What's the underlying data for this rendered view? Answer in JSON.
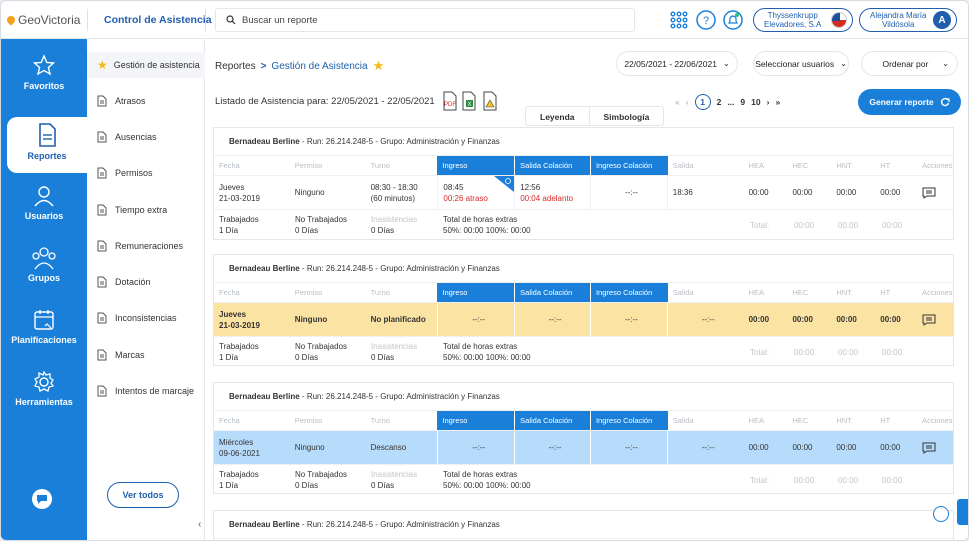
{
  "app": {
    "logo": "GeoVictoria",
    "module": "Control de Asistencia"
  },
  "search": {
    "placeholder": "Buscar un reporte"
  },
  "company": {
    "line1": "Thyssenkrupp",
    "line2": "Elevadores, S.A"
  },
  "user": {
    "line1": "Alejandra María",
    "line2": "Vildósola",
    "initial": "A"
  },
  "leftnav": [
    {
      "label": "Favoritos",
      "icon": "star-icon"
    },
    {
      "label": "Reportes",
      "icon": "report-icon",
      "active": true
    },
    {
      "label": "Usuarios",
      "icon": "users-icon"
    },
    {
      "label": "Grupos",
      "icon": "groups-icon"
    },
    {
      "label": "Planificaciones",
      "icon": "calendar-icon"
    },
    {
      "label": "Herramientas",
      "icon": "gear-icon"
    }
  ],
  "subnav": {
    "items": [
      "Gestión de asistencia",
      "Atrasos",
      "Ausencias",
      "Permisos",
      "Tiempo extra",
      "Remuneraciones",
      "Dotación",
      "Inconsistencias",
      "Marcas",
      "Intentos de marcaje"
    ],
    "ver_todos": "Ver todos"
  },
  "breadcrumb": {
    "root": "Reportes",
    "sep": ">",
    "current": "Gestión de Asistencia"
  },
  "filters": {
    "date_range": "22/05/2021 - 22/06/2021",
    "users": "Seleccionar usuarios",
    "order": "Ordenar por"
  },
  "list": {
    "title": "Listado de Asistencia para: 22/05/2021 - 22/05/2021"
  },
  "tabs": [
    "Leyenda",
    "Simbología"
  ],
  "pager": {
    "first": "«",
    "prev": "‹",
    "current": "1",
    "p2": "2",
    "dots": "...",
    "p9": "9",
    "p10": "10",
    "next": "›",
    "last": "»"
  },
  "generate_label": "Generar reporte",
  "columns": [
    "Fecha",
    "Permiso",
    "Turno",
    "Ingreso",
    "Salida Colación",
    "Ingreso Colación",
    "Salida",
    "HEA",
    "HEC",
    "HNT",
    "HT",
    "Acciones"
  ],
  "cards": [
    {
      "name": "Bernadeau Berline",
      "run_label": " - Run: 26.214.248-5 - Grupo: Administración y Finanzas",
      "row": {
        "day": "Jueves",
        "date": "21-03-2019",
        "permiso": "Ninguno",
        "turno1": "08:30 - 18:30",
        "turno2": "(60 minutos)",
        "ingreso": "08:45",
        "ingreso_note": "00:26 atraso",
        "salida_col": "12:56",
        "salida_col_note": "00:04 adelanto",
        "ingreso_col": "--:--",
        "salida": "18:36",
        "hea": "00:00",
        "hec": "00:00",
        "hnt": "00:00",
        "ht": "00:00"
      }
    },
    {
      "name": "Bernadeau Berline",
      "run_label": " - Run: 26.214.248-5 - Grupo: Administración y Finanzas",
      "row": {
        "day": "Jueves",
        "date": "21-03-2019",
        "permiso": "Ninguno",
        "turno1": "No planificado",
        "ingreso": "--:--",
        "salida_col": "--:--",
        "ingreso_col": "--:--",
        "salida": "--:--",
        "hea": "00:00",
        "hec": "00:00",
        "hnt": "00:00",
        "ht": "00:00"
      }
    },
    {
      "name": "Bernadeau Berline",
      "run_label": " - Run: 26.214.248-5 - Grupo: Administración y Finanzas",
      "row": {
        "day": "Miércoles",
        "date": "09-06-2021",
        "permiso": "Ninguno",
        "turno1": "Descanso",
        "ingreso": "--:--",
        "salida_col": "--:--",
        "ingreso_col": "--:--",
        "salida": "--:--",
        "hea": "00:00",
        "hec": "00:00",
        "hnt": "00:00",
        "ht": "00:00"
      }
    },
    {
      "name": "Bernadeau Berline",
      "run_label": " - Run: 26.214.248-5 - Grupo: Administración y Finanzas"
    }
  ],
  "summary": {
    "trabajados_label": "Trabajados",
    "trabajados_val": "1 Día",
    "no_trab_label": "No Trabajados",
    "no_trab_val": "0 Días",
    "inasist_label": "Inasistencias",
    "inasist_val": "0 Días",
    "extras_label": "Total de horas extras",
    "extras_val": "50%: 00:00   100%: 00:00",
    "total_label": "Total:",
    "t1": "00:00",
    "t2": "00:00",
    "t3": "00:00"
  },
  "colors": {
    "primary": "#1a7fd9",
    "accent": "#1f5fae",
    "warning_row": "#fbe3a4",
    "info_row": "#b7dcfb",
    "late": "#d62b2b"
  }
}
